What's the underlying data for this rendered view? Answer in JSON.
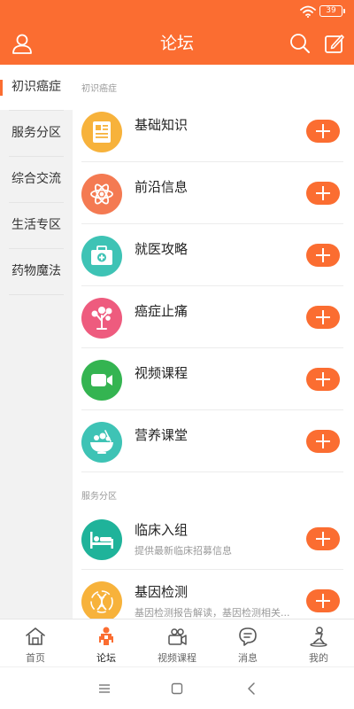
{
  "status_bar": {
    "battery": "39"
  },
  "header": {
    "title": "论坛"
  },
  "sidebar": {
    "items": [
      {
        "label": "初识癌症",
        "active": true
      },
      {
        "label": "服务分区",
        "active": false
      },
      {
        "label": "综合交流",
        "active": false
      },
      {
        "label": "生活专区",
        "active": false
      },
      {
        "label": "药物魔法",
        "active": false
      }
    ]
  },
  "sections": [
    {
      "title": "初识癌症",
      "items": [
        {
          "title": "基础知识",
          "icon": "document-icon",
          "color": "#f7b23b"
        },
        {
          "title": "前沿信息",
          "icon": "atom-icon",
          "color": "#f47a52"
        },
        {
          "title": "就医攻略",
          "icon": "medical-kit-icon",
          "color": "#3ec3b5"
        },
        {
          "title": "癌症止痛",
          "icon": "tree-icon",
          "color": "#ee5b7e"
        },
        {
          "title": "视频课程",
          "icon": "video-camera-icon",
          "color": "#34b451"
        },
        {
          "title": "营养课堂",
          "icon": "food-bowl-icon",
          "color": "#3ec3b5"
        }
      ]
    },
    {
      "title": "服务分区",
      "items": [
        {
          "title": "临床入组",
          "subtitle": "提供最新临床招募信息",
          "icon": "hospital-bed-icon",
          "color": "#1fb39a"
        },
        {
          "title": "基因检测",
          "subtitle": "基因检测报告解读，基因检测相关...",
          "icon": "dna-icon",
          "color": "#f7b23b"
        }
      ]
    }
  ],
  "tabbar": {
    "items": [
      {
        "label": "首页",
        "icon": "home-icon",
        "active": false
      },
      {
        "label": "论坛",
        "icon": "forum-icon",
        "active": true
      },
      {
        "label": "视频课程",
        "icon": "video-course-icon",
        "active": false
      },
      {
        "label": "消息",
        "icon": "message-icon",
        "active": false
      },
      {
        "label": "我的",
        "icon": "profile-icon",
        "active": false
      }
    ]
  },
  "colors": {
    "accent": "#fb6d31",
    "sidebar_bg": "#f2f2f2"
  }
}
